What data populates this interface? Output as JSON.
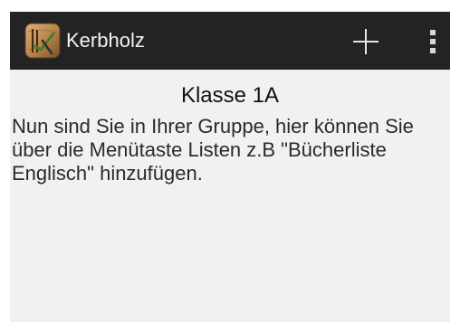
{
  "action_bar": {
    "app_title": "Kerbholz",
    "app_icon": "kerbholz-app-icon",
    "add_icon": "plus-icon",
    "overflow_icon": "vertical-dots-icon",
    "background_color": "#232323"
  },
  "content": {
    "group_title": "Klasse 1A",
    "message": "Nun sind Sie in Ihrer Gruppe, hier können Sie über die Menütaste Listen z.B \"Bücherliste Englisch\" hinzufügen.",
    "background_color": "#f1f1f1"
  }
}
